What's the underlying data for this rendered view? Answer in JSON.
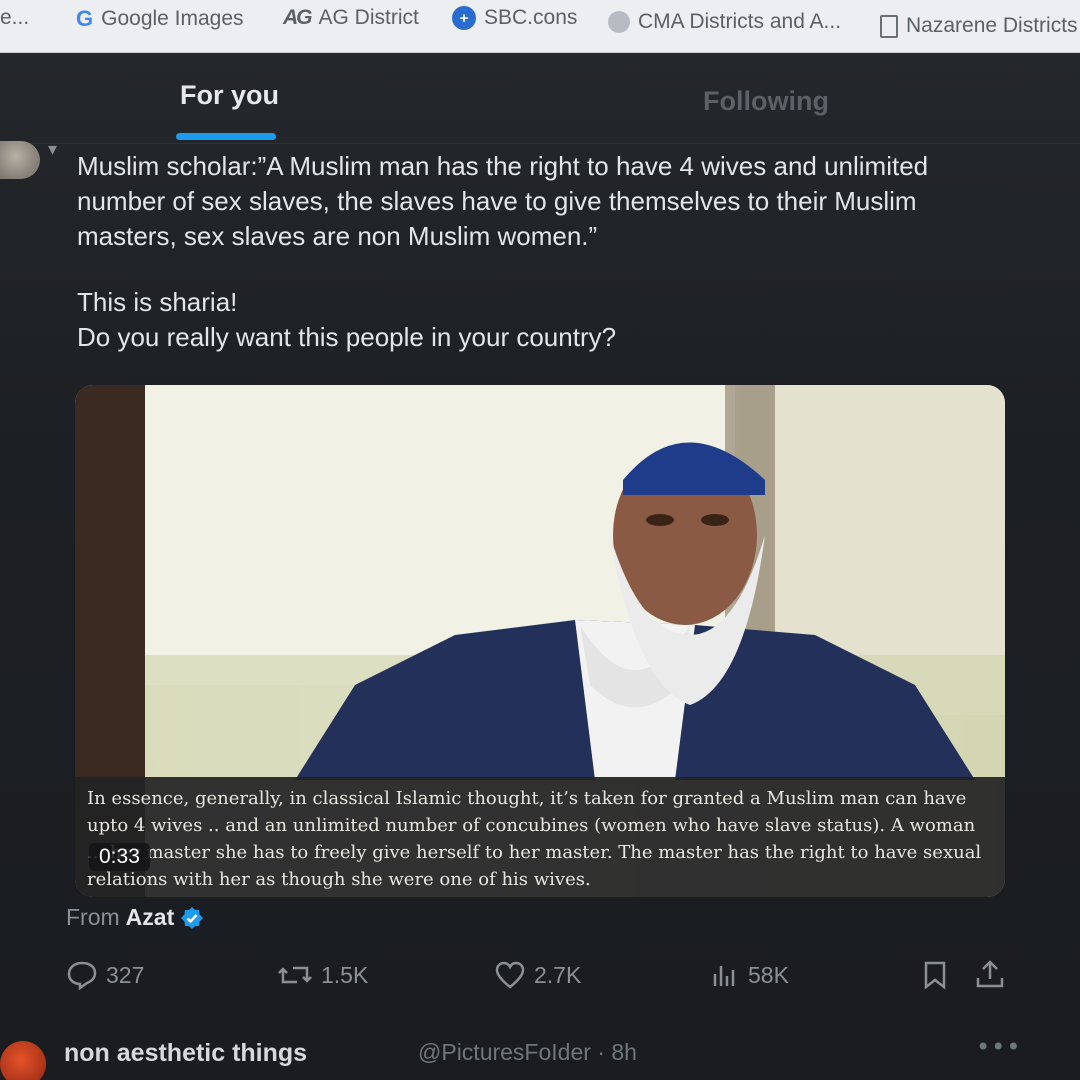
{
  "bookmarks": [
    {
      "label": "e...",
      "icon": "none"
    },
    {
      "label": "Google Images",
      "icon": "google-icon"
    },
    {
      "label": "AG District",
      "icon": "ag-logo-icon"
    },
    {
      "label": "SBC.cons",
      "icon": "sbc-icon"
    },
    {
      "label": "CMA Districts and A...",
      "icon": "globe-icon"
    },
    {
      "label": "Nazarene Districts",
      "icon": "document-icon"
    }
  ],
  "tabs": {
    "for_you": "For you",
    "following": "Following",
    "active": "for_you"
  },
  "tweet": {
    "lines": [
      "Muslim scholar:”A Muslim man has the right to have 4 wives and unlimited number of sex slaves, the slaves have to give themselves to their Muslim masters, sex slaves are non Muslim women.”",
      "This is sharia!",
      "Do you really want this people in your country?"
    ],
    "video_caption": "In essence, generally, in classical Islamic thought, it’s taken for granted a Muslim man can have upto 4 wives .. and an unlimited number of concubines (women who have slave status). A woman ... her master she has to freely give herself to her master. The master has the right to have sexual relations with her as though she were one of his wives.",
    "video_time": "0:33",
    "from_label": "From",
    "from_name": "Azat",
    "replies": "327",
    "reposts": "1.5K",
    "likes": "2.7K",
    "views": "58K"
  },
  "next_tweet": {
    "name": "non aesthetic things",
    "handle": "@PicturesFoIder · 8h"
  },
  "colors": {
    "accent": "#1d9bf0",
    "text": "#e7e9ea",
    "muted": "#8b9096",
    "background": "#1a1c1f"
  }
}
